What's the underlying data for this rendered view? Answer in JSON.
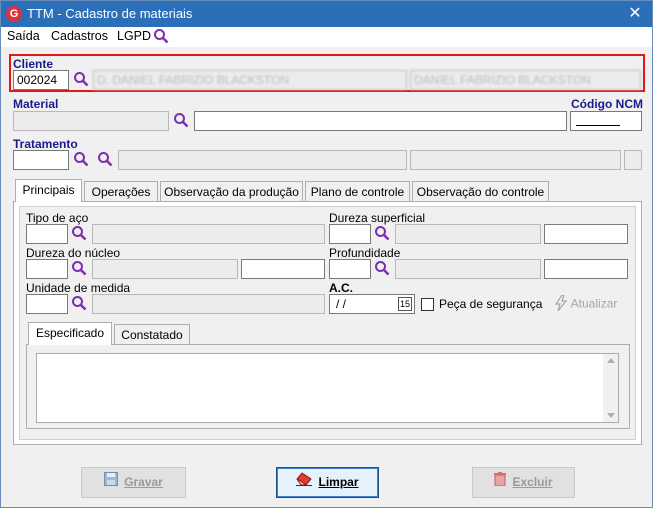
{
  "window": {
    "title": "TTM - Cadastro de materiais",
    "app_icon": "G",
    "close_glyph": "✕"
  },
  "menu": {
    "items": [
      "Saída",
      "Cadastros",
      "LGPD"
    ]
  },
  "cliente": {
    "label": "Cliente",
    "code": "002024",
    "name_blurred": "D. DANIEL FABRIZIO BLACKSTON",
    "name2_blurred": "DANIEL FABRIZIO BLACKSTON"
  },
  "material": {
    "label": "Material",
    "value": "",
    "description": ""
  },
  "codigo_ncm": {
    "label": "Código NCM",
    "value": ""
  },
  "tratamento": {
    "label": "Tratamento"
  },
  "tabs": [
    "Principais",
    "Operações",
    "Observação da produção",
    "Plano de controle",
    "Observação do controle"
  ],
  "principais": {
    "tipo_aco": "Tipo de aço",
    "dureza_superficial": "Dureza superficial",
    "dureza_nucleo": "Dureza do núcleo",
    "profundidade": "Profundidade",
    "unidade_medida": "Unidade de medida",
    "ac_label": "A.C.",
    "ac_value": " / /",
    "calendar_badge": "15",
    "peca_seguranca": "Peça de segurança",
    "atualizar": "Atualizar"
  },
  "subtabs": [
    "Especificado",
    "Constatado"
  ],
  "buttons": {
    "gravar": "Gravar",
    "limpar": "Limpar",
    "excluir": "Excluir"
  },
  "colors": {
    "titlebar": "#2a6fb8",
    "label_blue": "#1a1a8c",
    "highlight_red": "#e01818",
    "magnifier": "#7a2fb0"
  },
  "icons": {
    "search": "magnifier-icon",
    "calendar": "calendar-icon",
    "save": "floppy-icon",
    "clear": "eraser-icon",
    "delete": "trash-icon",
    "refresh": "lightning-icon"
  }
}
